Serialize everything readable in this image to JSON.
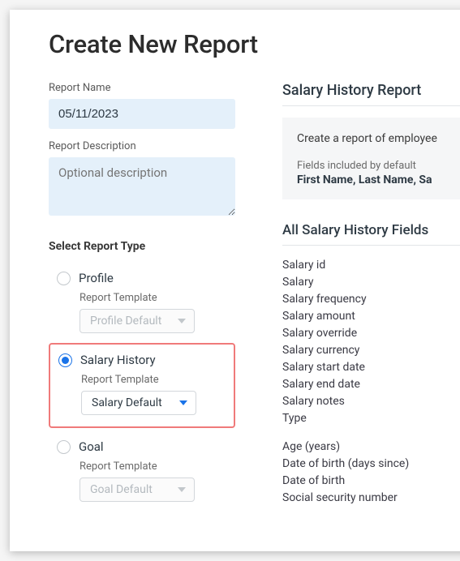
{
  "page_title": "Create New Report",
  "form": {
    "report_name_label": "Report Name",
    "report_name_value": "05/11/2023",
    "report_desc_label": "Report Description",
    "report_desc_placeholder": "Optional description",
    "select_type_label": "Select Report Type",
    "template_sublabel": "Report Template"
  },
  "types": {
    "profile": {
      "label": "Profile",
      "template": "Profile Default"
    },
    "salary": {
      "label": "Salary History",
      "template": "Salary Default"
    },
    "goal": {
      "label": "Goal",
      "template": "Goal Default"
    }
  },
  "preview": {
    "title": "Salary History Report",
    "description": "Create a report of employee",
    "included_label": "Fields included by default",
    "included_fields": "First Name, Last Name, Sa"
  },
  "all_fields_title": "All Salary History Fields",
  "all_fields_group1": [
    "Salary id",
    "Salary",
    "Salary frequency",
    "Salary amount",
    "Salary override",
    "Salary currency",
    "Salary start date",
    "Salary end date",
    "Salary notes",
    "Type"
  ],
  "all_fields_group2": [
    "Age (years)",
    "Date of birth (days since)",
    "Date of birth",
    "Social security number"
  ]
}
